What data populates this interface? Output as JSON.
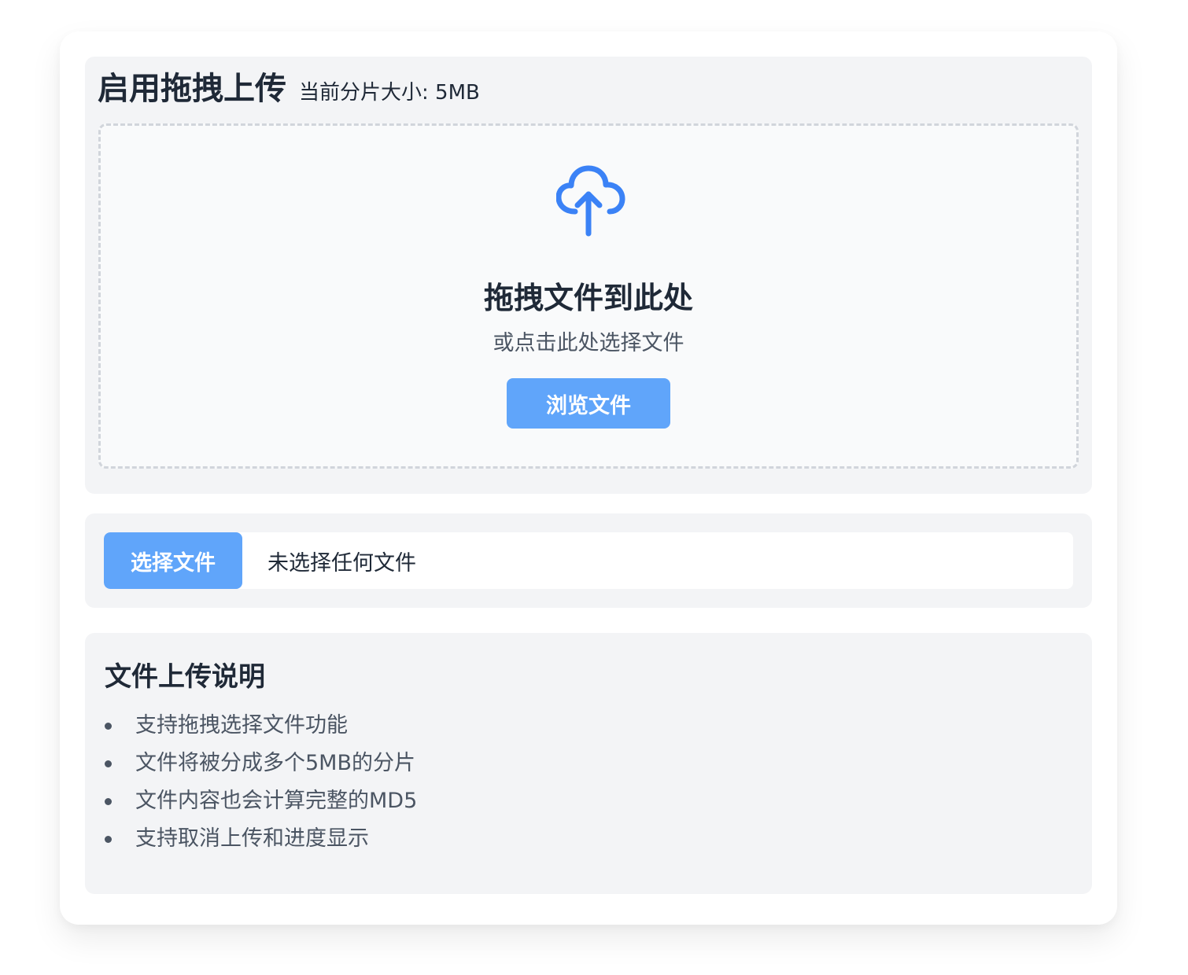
{
  "drag_panel": {
    "title": "启用拖拽上传",
    "chunk_info": "当前分片大小: 5MB",
    "drop_zone": {
      "icon": "cloud-upload-icon",
      "title": "拖拽文件到此处",
      "subtitle": "或点击此处选择文件",
      "browse_label": "浏览文件"
    }
  },
  "file_select": {
    "button_label": "选择文件",
    "status_text": "未选择任何文件"
  },
  "info": {
    "title": "文件上传说明",
    "items": [
      "支持拖拽选择文件功能",
      "文件将被分成多个5MB的分片",
      "文件内容也会计算完整的MD5",
      "支持取消上传和进度显示"
    ]
  },
  "colors": {
    "accent": "#60a5fa",
    "icon": "#3b82f6",
    "panel_bg": "#f3f4f6",
    "text_dark": "#1f2937",
    "text_muted": "#4b5563"
  }
}
